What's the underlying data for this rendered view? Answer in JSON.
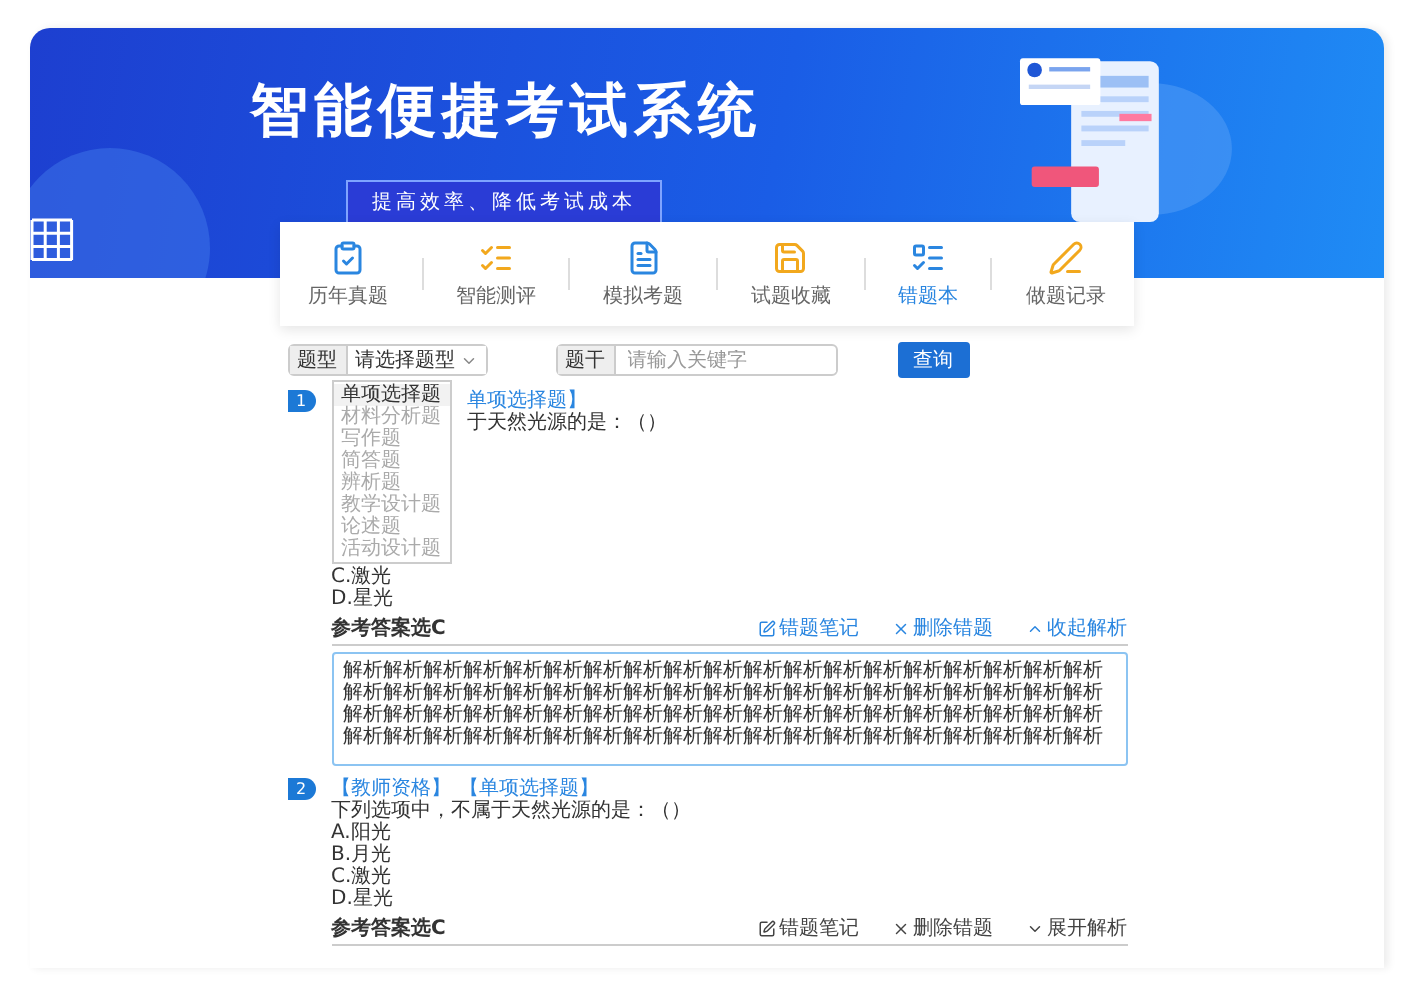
{
  "banner": {
    "title": "智能便捷考试系统",
    "subtitle": "提高效率、降低考试成本"
  },
  "nav": [
    {
      "label": "历年真题",
      "selected": false
    },
    {
      "label": "智能测评",
      "selected": false
    },
    {
      "label": "模拟考题",
      "selected": false
    },
    {
      "label": "试题收藏",
      "selected": false
    },
    {
      "label": "错题本",
      "selected": true
    },
    {
      "label": "做题记录",
      "selected": false
    }
  ],
  "filter": {
    "type_label": "题型",
    "type_select": "请选择题型",
    "type_options": [
      {
        "label": "单项选择题",
        "selected": true
      },
      {
        "label": "材料分析题",
        "selected": false
      },
      {
        "label": "写作题",
        "selected": false
      },
      {
        "label": "简答题",
        "selected": false
      },
      {
        "label": "辨析题",
        "selected": false
      },
      {
        "label": "教学设计题",
        "selected": false
      },
      {
        "label": "论述题",
        "selected": false
      },
      {
        "label": "活动设计题",
        "selected": false
      }
    ],
    "stem_label": "题干",
    "stem_placeholder": "请输入关键字",
    "search_button": "查询"
  },
  "questions": [
    {
      "number": "1",
      "under_dropdown": true,
      "tags": [
        "单项选择题】"
      ],
      "stem": "于天然光源的是：（）",
      "options": [
        "C.激光",
        "D.星光"
      ],
      "answer": "参考答案选C",
      "note": "错题笔记",
      "delete": "删除错题",
      "toggle": "收起解析",
      "expanded": true,
      "analysis": "解析解析解析解析解析解析解析解析解析解析解析解析解析解析解析解析解析解析解析解析解析解析解析解析解析解析解析解析解析解析解析解析解析解析解析解析解析解析解析解析解析解析解析解析解析解析解析解析解析解析解析解析解析解析解析解析解析解析解析解析解析解析解析解析解析解析解析解析解析解析解析解析解析解析解析解析"
    },
    {
      "number": "2",
      "under_dropdown": false,
      "tags": [
        "【教师资格】",
        "【单项选择题】"
      ],
      "stem": "下列选项中，不属于天然光源的是：（）",
      "options": [
        "A.阳光",
        "B.月光",
        "C.激光",
        "D.星光"
      ],
      "answer": "参考答案选C",
      "note": "错题笔记",
      "delete": "删除错题",
      "toggle": "展开解析",
      "expanded": false
    }
  ]
}
